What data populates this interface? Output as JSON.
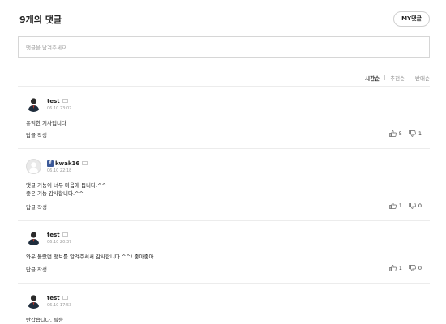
{
  "header": {
    "count_number": "9",
    "count_suffix": "개의 댓글",
    "my_comments_button": "MY댓글"
  },
  "input": {
    "placeholder": "댓글을 남겨주세요"
  },
  "sort": {
    "options": [
      "시간순",
      "추천순",
      "반대순"
    ],
    "active": "시간순"
  },
  "comments": [
    {
      "user": "test",
      "date": "06.10 23:07",
      "lines": [
        "유익한 기사입니다"
      ],
      "reply_label": "답글 작성",
      "likes": "5",
      "dislikes": "1",
      "avatar": "person-icon"
    },
    {
      "user": "kwak16",
      "date": "06.10 22:18",
      "lines": [
        "댓글 기능이 너무 마음에 듭니다.^^",
        "좋은 기능 감사합니다.^^"
      ],
      "reply_label": "답글 작성",
      "likes": "1",
      "dislikes": "0",
      "avatar": "default-avatar",
      "social": "facebook-icon"
    },
    {
      "user": "test",
      "date": "06.10 20:37",
      "lines": [
        "와우 몰랐던 정보를 알려주셔서 감사합니다 ^^! 좋아좋아"
      ],
      "reply_label": "답글 작성",
      "likes": "1",
      "dislikes": "0",
      "avatar": "person-icon"
    },
    {
      "user": "test",
      "date": "06.10 17:53",
      "lines": [
        "반갑습니다. 필승"
      ],
      "avatar": "person-icon"
    }
  ],
  "colors": {
    "facebook": "#3b5998",
    "border": "#d6d6d6",
    "muted": "#999999"
  }
}
